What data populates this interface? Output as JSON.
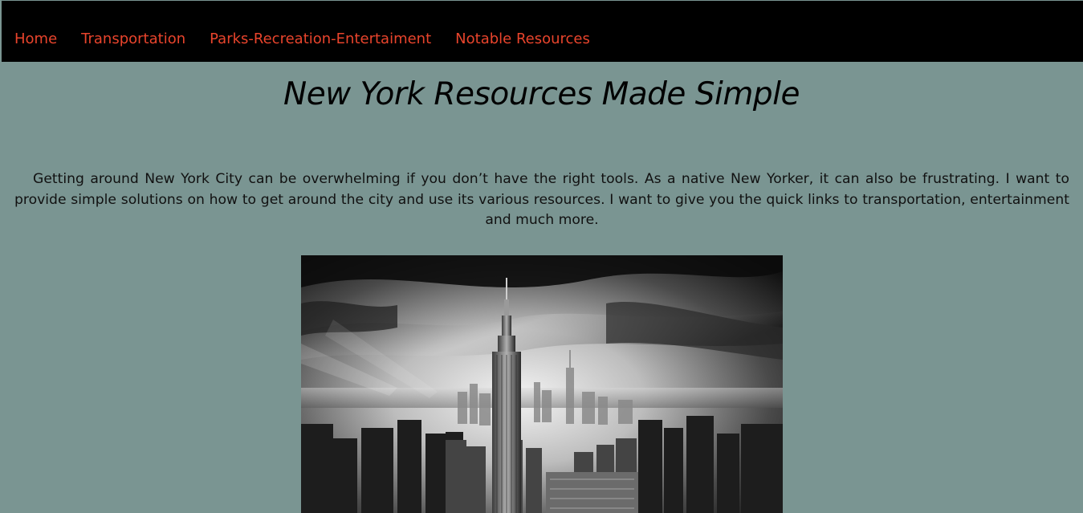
{
  "nav": {
    "items": [
      {
        "label": "Home"
      },
      {
        "label": "Transportation"
      },
      {
        "label": "Parks-Recreation-Entertaiment"
      },
      {
        "label": "Notable Resources"
      }
    ]
  },
  "header": {
    "title": "New York Resources Made Simple"
  },
  "main": {
    "intro": "Getting around New York City can be overwhelming if you don’t have the right tools. As a native New Yorker, it can also be frustrating. I want to provide simple solutions on how to get around the city and use its various resources. I want to give you the quick links to transportation, entertainment and much more."
  },
  "colors": {
    "background": "#7a9592",
    "navbar": "#000000",
    "nav_link": "#e8442c",
    "text": "#111111"
  }
}
